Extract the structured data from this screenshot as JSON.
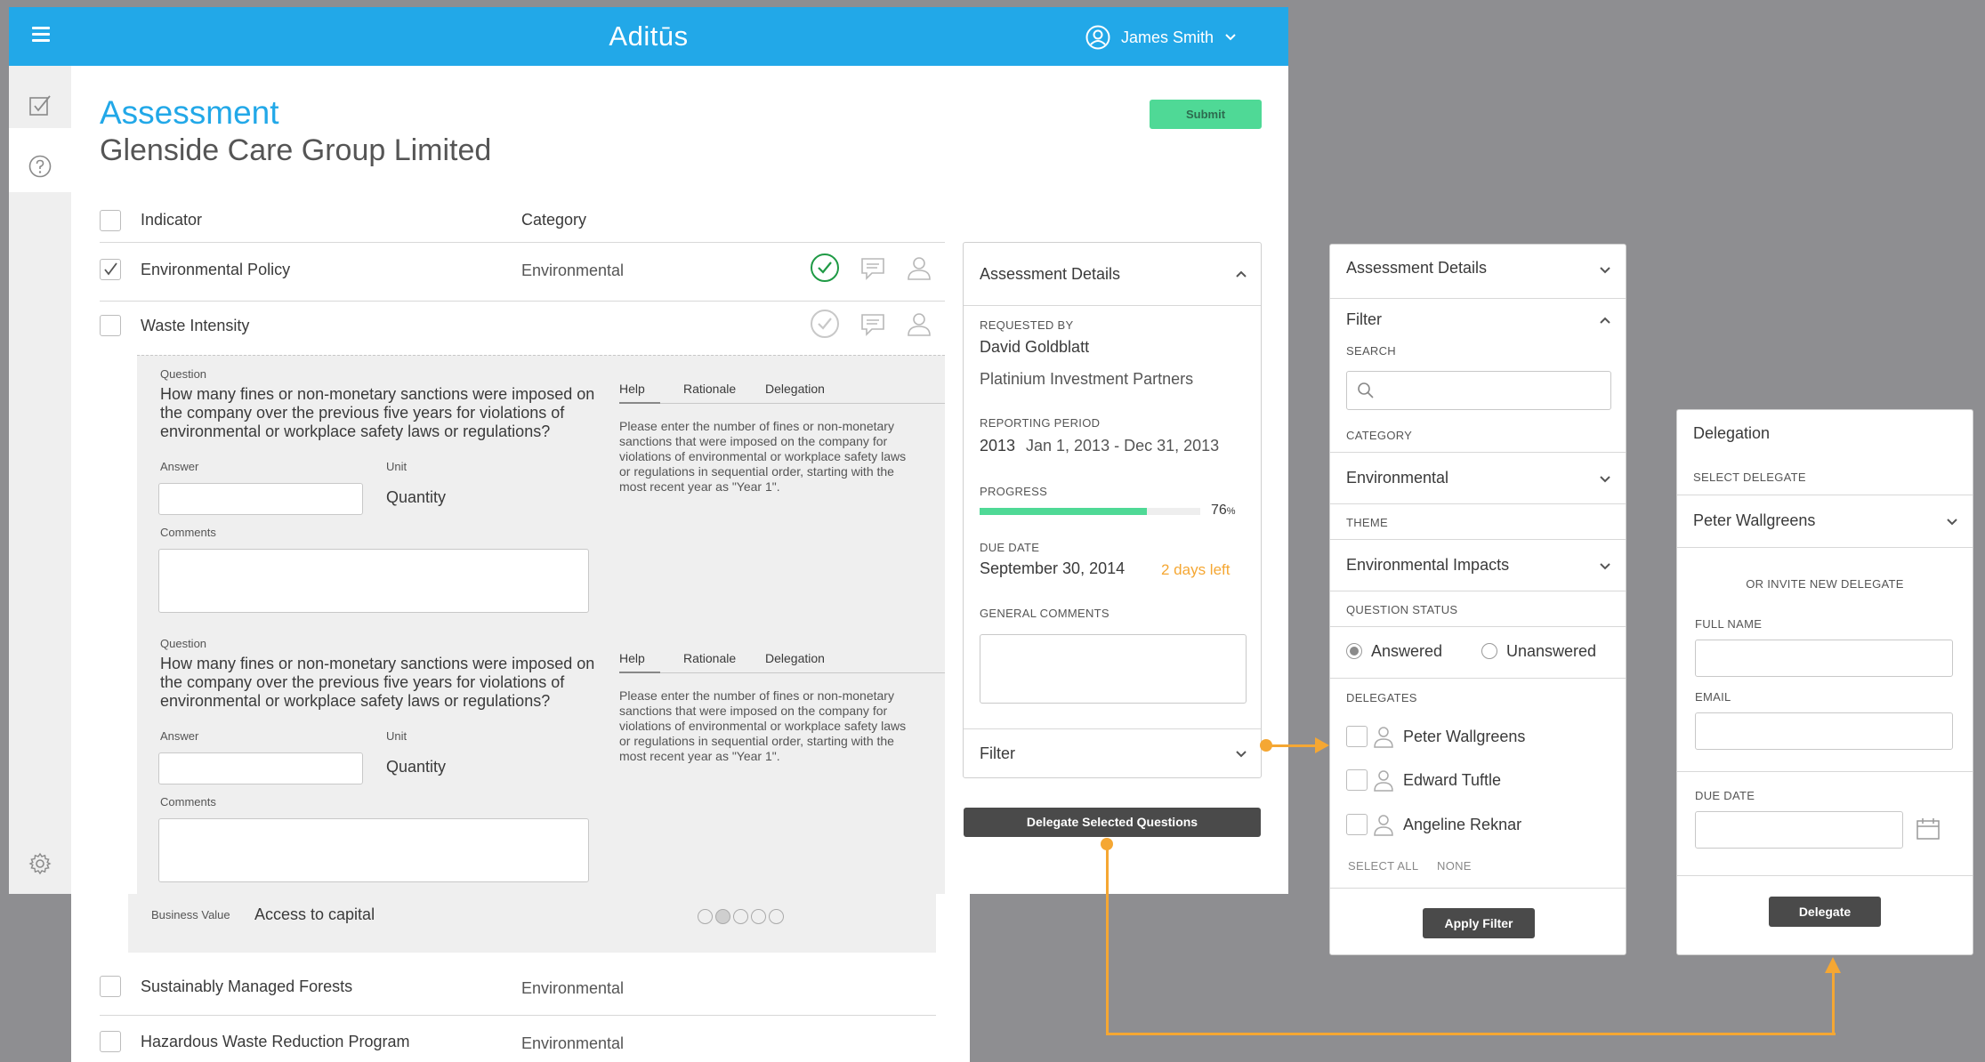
{
  "app": {
    "brand": "Aditūs",
    "user_name": "James Smith"
  },
  "page": {
    "title": "Assessment",
    "subtitle": "Glenside Care Group Limited",
    "submit_label": "Submit"
  },
  "table": {
    "headers": {
      "indicator": "Indicator",
      "category": "Category"
    },
    "rows": [
      {
        "indicator": "Environmental Policy",
        "category": "Environmental",
        "checked": true,
        "status": "complete"
      },
      {
        "indicator": "Waste Intensity",
        "category": "",
        "checked": false,
        "status": "pending"
      },
      {
        "indicator": "Sustainably Managed Forests",
        "category": "Environmental",
        "checked": false
      },
      {
        "indicator": "Hazardous Waste Reduction Program",
        "category": "Environmental",
        "checked": false
      }
    ]
  },
  "questions": [
    {
      "label": "Question",
      "text": "How many fines or non-monetary sanctions were imposed on the company over the previous five years for violations of environmental or workplace safety laws or regulations?",
      "answer_label": "Answer",
      "answer_value": "",
      "unit_label": "Unit",
      "unit_value": "Quantity",
      "comments_label": "Comments",
      "tabs": [
        "Help",
        "Rationale",
        "Delegation"
      ],
      "help_text": "Please enter the number of fines or non-monetary sanctions that were imposed on the company for violations of environmental or workplace safety laws or regulations in sequential order, starting with the most recent year as \"Year 1\"."
    },
    {
      "label": "Question",
      "text": "How many fines or non-monetary sanctions were imposed on the company over the previous five years for violations of environmental or workplace safety laws or regulations?",
      "answer_label": "Answer",
      "answer_value": "",
      "unit_label": "Unit",
      "unit_value": "Quantity",
      "comments_label": "Comments",
      "tabs": [
        "Help",
        "Rationale",
        "Delegation"
      ],
      "help_text": "Please enter the number of fines or non-monetary sanctions that were imposed on the company for violations of environmental or workplace safety laws or regulations in sequential order, starting with the most recent year as \"Year 1\"."
    }
  ],
  "business_value": {
    "label": "Business Value",
    "value": "Access to capital",
    "rating": 2,
    "max": 5
  },
  "details_card": {
    "title": "Assessment Details",
    "requested_by_label": "REQUESTED BY",
    "requested_by_name": "David Goldblatt",
    "requested_by_org": "Platinium Investment Partners",
    "reporting_period_label": "REPORTING PERIOD",
    "reporting_year": "2013",
    "reporting_range": "Jan 1, 2013 - Dec 31, 2013",
    "progress_label": "PROGRESS",
    "progress_value": "76",
    "progress_unit": "%",
    "progress_fraction": 0.76,
    "due_date_label": "DUE DATE",
    "due_date": "September 30, 2014",
    "days_left": "2 days left",
    "general_comments_label": "GENERAL COMMENTS",
    "filter_label": "Filter"
  },
  "delegate_button": "Delegate Selected Questions",
  "filter_card": {
    "details_title": "Assessment Details",
    "filter_title": "Filter",
    "search_label": "SEARCH",
    "search_placeholder": "",
    "category_label": "CATEGORY",
    "category_value": "Environmental",
    "theme_label": "THEME",
    "theme_value": "Environmental Impacts",
    "status_label": "QUESTION STATUS",
    "status_answered": "Answered",
    "status_unanswered": "Unanswered",
    "delegates_label": "DELEGATES",
    "delegates": [
      "Peter Wallgreens",
      "Edward Tuftle",
      "Angeline Reknar"
    ],
    "select_all": "SELECT ALL",
    "select_none": "NONE",
    "apply_label": "Apply Filter"
  },
  "delegation_card": {
    "title": "Delegation",
    "select_label": "SELECT DELEGATE",
    "selected_delegate": "Peter Wallgreens",
    "invite_label": "OR INVITE NEW DELEGATE",
    "full_name_label": "FULL NAME",
    "email_label": "EMAIL",
    "due_date_label": "DUE DATE",
    "delegate_label": "Delegate"
  },
  "colors": {
    "brand": "#22a8e8",
    "submit": "#4fd996",
    "progress": "#4fd996",
    "days_left": "#f5a733",
    "connector": "#f5a733",
    "check_ok": "#1f9a45"
  }
}
